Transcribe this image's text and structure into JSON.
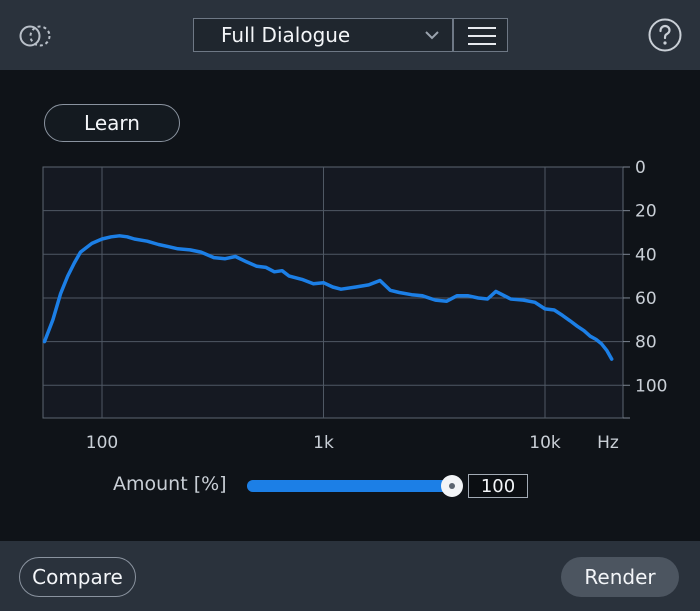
{
  "header": {
    "preset": {
      "selected": "Full Dialogue"
    },
    "icons": {
      "logo": "module-logo-icon",
      "chevron": "chevron-down-icon",
      "menu": "hamburger-menu-icon",
      "help": "help-icon"
    }
  },
  "learn": {
    "label": "Learn"
  },
  "chart_data": {
    "type": "line",
    "x_scale": "log",
    "xlim": [
      55,
      800000
    ],
    "ylim": [
      0,
      115
    ],
    "y_inverted": true,
    "x_ticks": [
      {
        "value": 100,
        "label": "100"
      },
      {
        "value": 1000,
        "label": "1k"
      },
      {
        "value": 10000,
        "label": "10k"
      }
    ],
    "x_unit": "Hz",
    "y_ticks": [
      {
        "value": 0,
        "label": "0"
      },
      {
        "value": 20,
        "label": "20"
      },
      {
        "value": 40,
        "label": "40"
      },
      {
        "value": 60,
        "label": "60"
      },
      {
        "value": 80,
        "label": "80"
      },
      {
        "value": 100,
        "label": "100"
      }
    ],
    "grid": true,
    "series": [
      {
        "color": "#1c7fe6",
        "x": [
          55,
          60,
          65,
          70,
          75,
          80,
          90,
          100,
          110,
          120,
          130,
          140,
          160,
          180,
          200,
          220,
          250,
          280,
          320,
          360,
          400,
          450,
          500,
          550,
          600,
          650,
          700,
          800,
          900,
          1000,
          1100,
          1200,
          1400,
          1600,
          1800,
          2000,
          2200,
          2500,
          2800,
          3200,
          3600,
          4000,
          4500,
          5000,
          5500,
          6000,
          7000,
          8000,
          9000,
          10000,
          11000,
          12000,
          13000,
          14000,
          15000,
          16000,
          17000,
          18000,
          19000,
          20000
        ],
        "y": [
          80,
          70,
          58,
          50,
          44,
          39,
          35,
          33,
          32,
          31.5,
          32,
          33,
          34,
          35.5,
          36.5,
          37.5,
          38,
          39,
          41.5,
          42,
          41,
          43.5,
          45.5,
          46,
          48,
          47.5,
          50,
          51.5,
          53.5,
          53,
          55,
          56,
          55,
          54,
          52,
          56.5,
          57.5,
          58.5,
          59,
          61,
          61.5,
          59,
          59,
          60,
          60.5,
          57,
          60.5,
          61,
          62,
          65,
          65.5,
          68,
          70.5,
          73,
          75,
          77.5,
          79,
          81,
          84,
          88
        ]
      }
    ]
  },
  "amount": {
    "label": "Amount [%]",
    "value": "100",
    "fraction": 1.0
  },
  "footer": {
    "compare_label": "Compare",
    "render_label": "Render"
  },
  "colors": {
    "accent": "#1c7fe6",
    "bar": "#2a323c",
    "background": "#0f1318"
  }
}
